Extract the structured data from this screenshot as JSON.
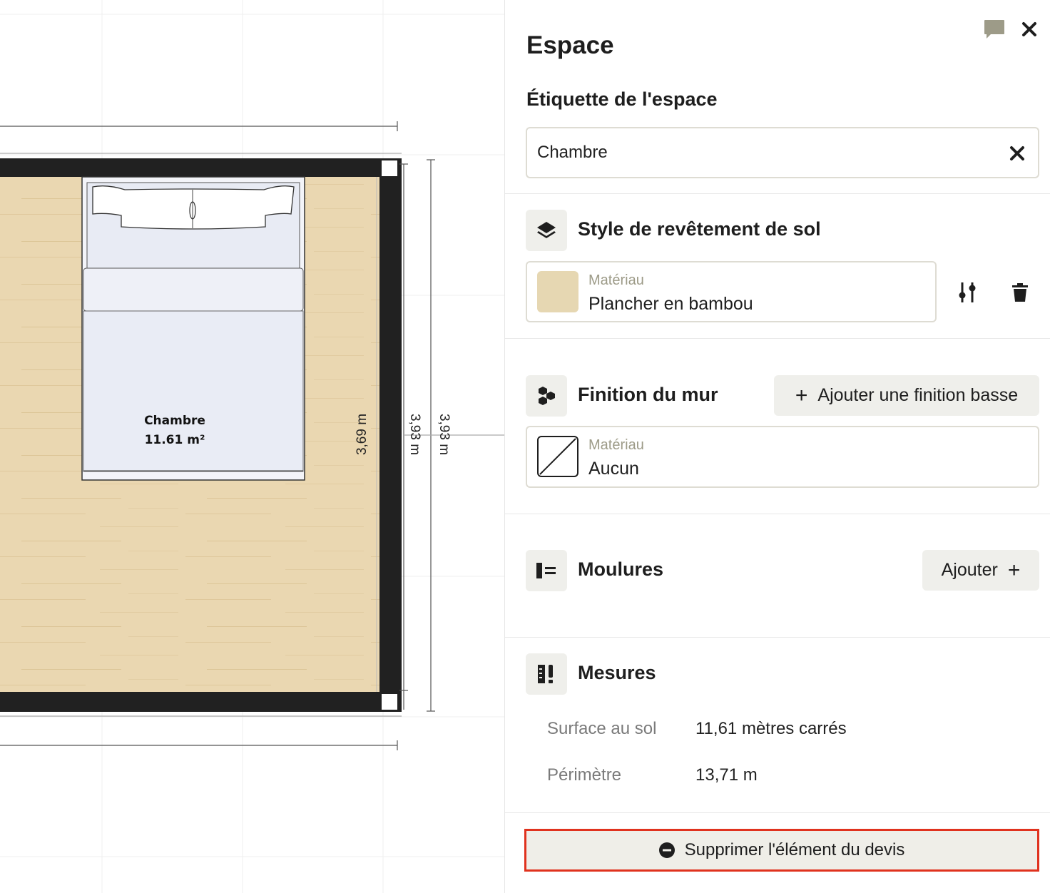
{
  "canvas": {
    "room": {
      "name": "Chambre",
      "area": "11.61 m²"
    },
    "dimensions": {
      "inner": "3,69 m",
      "wall": "3,93 m",
      "outer": "3,93 m"
    },
    "colors": {
      "floor": "#ead7b1",
      "wall": "#212121",
      "bed": "#e9ecf5"
    }
  },
  "panel": {
    "title": "Espace",
    "comment_icon": "speech-bubble-icon",
    "close_icon": "close-icon",
    "label_section": {
      "heading": "Étiquette de l'espace",
      "value": "Chambre",
      "clear_icon": "clear-icon"
    },
    "flooring": {
      "title": "Style de revêtement de sol",
      "icon": "layers-icon",
      "material_caption": "Matériau",
      "material_value": "Plancher en bambou",
      "swatch_color": "#e6d7b2",
      "adjust_icon": "sliders-icon",
      "delete_icon": "trash-icon"
    },
    "wall_finish": {
      "title": "Finition du mur",
      "icon": "hexagons-icon",
      "add_button": "Ajouter une finition basse",
      "material_caption": "Matériau",
      "material_value": "Aucun"
    },
    "moldings": {
      "title": "Moulures",
      "icon": "molding-icon",
      "add_button": "Ajouter"
    },
    "measures": {
      "title": "Mesures",
      "icon": "measure-icon",
      "rows": [
        {
          "label": "Surface au sol",
          "value": "11,61 mètres carrés"
        },
        {
          "label": "Périmètre",
          "value": "13,71 m"
        }
      ]
    },
    "remove_button": "Supprimer l'élément du devis",
    "accent": "#e0321e"
  }
}
